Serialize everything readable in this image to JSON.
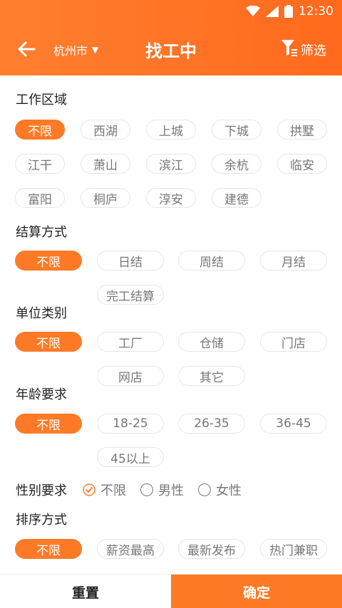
{
  "status_bar": {
    "time": "12:30"
  },
  "header": {
    "city": "杭州市",
    "title": "找工中",
    "filter_label": "筛选"
  },
  "sections": {
    "area": {
      "title": "工作区域",
      "options": [
        "不限",
        "西湖",
        "上城",
        "下城",
        "拱墅",
        "江干",
        "萧山",
        "滨江",
        "余杭",
        "临安",
        "富阳",
        "桐庐",
        "淳安",
        "建德"
      ],
      "selected": "不限"
    },
    "settlement": {
      "title": "结算方式",
      "options": [
        "不限",
        "日结",
        "周结",
        "月结",
        "完工结算"
      ],
      "selected": "不限"
    },
    "company_type": {
      "title": "单位类别",
      "options": [
        "不限",
        "工厂",
        "仓储",
        "门店",
        "网店",
        "其它"
      ],
      "selected": "不限"
    },
    "age": {
      "title": "年龄要求",
      "options": [
        "不限",
        "18-25",
        "26-35",
        "36-45",
        "45以上"
      ],
      "selected": "不限"
    },
    "gender": {
      "title": "性别要求",
      "options": [
        "不限",
        "男性",
        "女性"
      ],
      "selected": "不限"
    },
    "sort": {
      "title": "排序方式",
      "options": [
        "不限",
        "薪资最高",
        "最新发布",
        "热门兼职"
      ],
      "selected": "不限"
    }
  },
  "footer": {
    "reset_label": "重置",
    "confirm_label": "确定"
  },
  "colors": {
    "accent": "#ff7a26",
    "header_start": "#ff7f2f",
    "header_end": "#ff6a1d"
  }
}
